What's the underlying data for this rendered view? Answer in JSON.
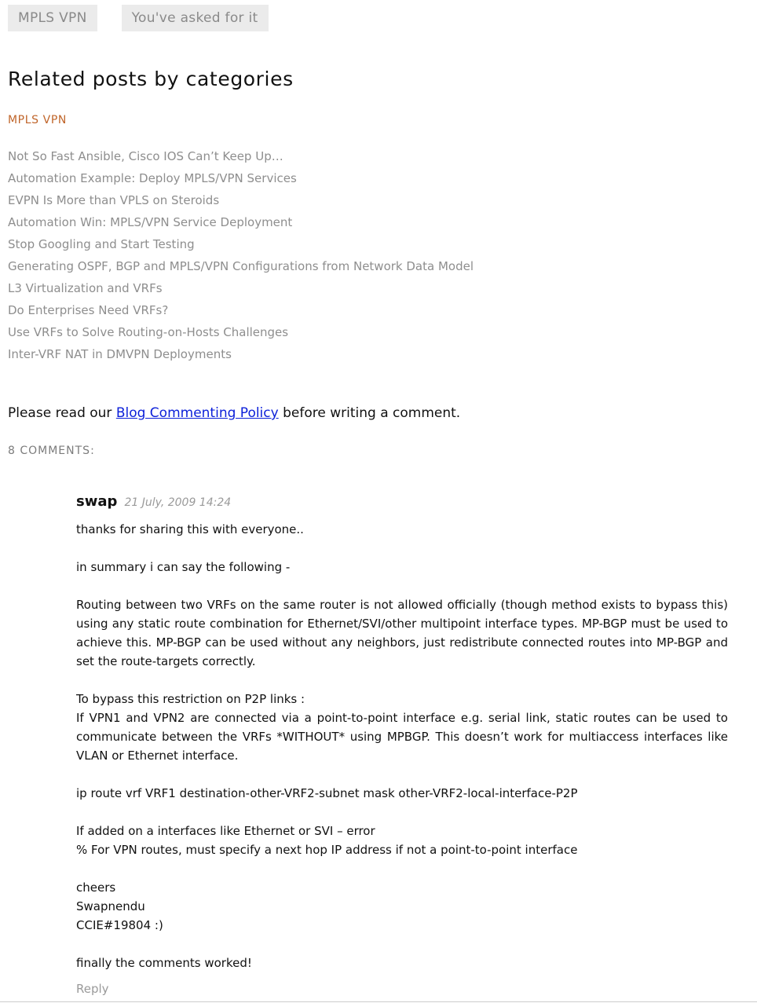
{
  "tags": [
    "MPLS VPN",
    "You've asked for it"
  ],
  "related": {
    "heading": "Related posts by categories",
    "category": "MPLS VPN",
    "posts": [
      "Not So Fast Ansible, Cisco IOS Can’t Keep Up…",
      "Automation Example: Deploy MPLS/VPN Services",
      "EVPN Is More than VPLS on Steroids",
      "Automation Win: MPLS/VPN Service Deployment",
      "Stop Googling and Start Testing",
      "Generating OSPF, BGP and MPLS/VPN Configurations from Network Data Model",
      "L3 Virtualization and VRFs",
      "Do Enterprises Need VRFs?",
      "Use VRFs to Solve Routing-on-Hosts Challenges",
      "Inter-VRF NAT in DMVPN Deployments"
    ]
  },
  "policy": {
    "prefix": "Please read our ",
    "link_text": "Blog Commenting Policy",
    "suffix": " before writing a comment."
  },
  "comments_count": "8 COMMENTS:",
  "comment": {
    "author": "swap",
    "date": "21 July, 2009 14:24",
    "paragraphs": [
      [
        "thanks for sharing this with everyone.."
      ],
      [
        "in summary i can say the following -"
      ],
      [
        "Routing between two VRFs on the same router is not allowed officially (though method exists to bypass this) using any static route combination for Ethernet/SVI/other multipoint interface types. MP-BGP must be used to achieve this. MP-BGP can be used without any neighbors, just redistribute connected routes into MP-BGP and set the route-targets correctly."
      ],
      [
        "To bypass this restriction on P2P links :",
        "If VPN1 and VPN2 are connected via a point-to-point interface e.g. serial link, static routes can be used to communicate between the VRFs *WITHOUT* using MPBGP. This doesn’t work for multiaccess interfaces like VLAN or Ethernet interface."
      ],
      [
        "ip route vrf VRF1 destination-other-VRF2-subnet mask other-VRF2-local-interface-P2P"
      ],
      [
        "If added on a interfaces like Ethernet or SVI – error",
        "% For VPN routes, must specify a next hop IP address if not a point-to-point interface"
      ],
      [
        "cheers",
        "Swapnendu",
        "CCIE#19804 :)"
      ],
      [
        "finally the comments worked!"
      ]
    ],
    "reply_label": "Reply"
  },
  "colors": {
    "category_accent": "#c0652a",
    "link_blue": "#0b1fd9",
    "muted_link": "#8e8e8e",
    "tag_background": "#ebebeb"
  }
}
